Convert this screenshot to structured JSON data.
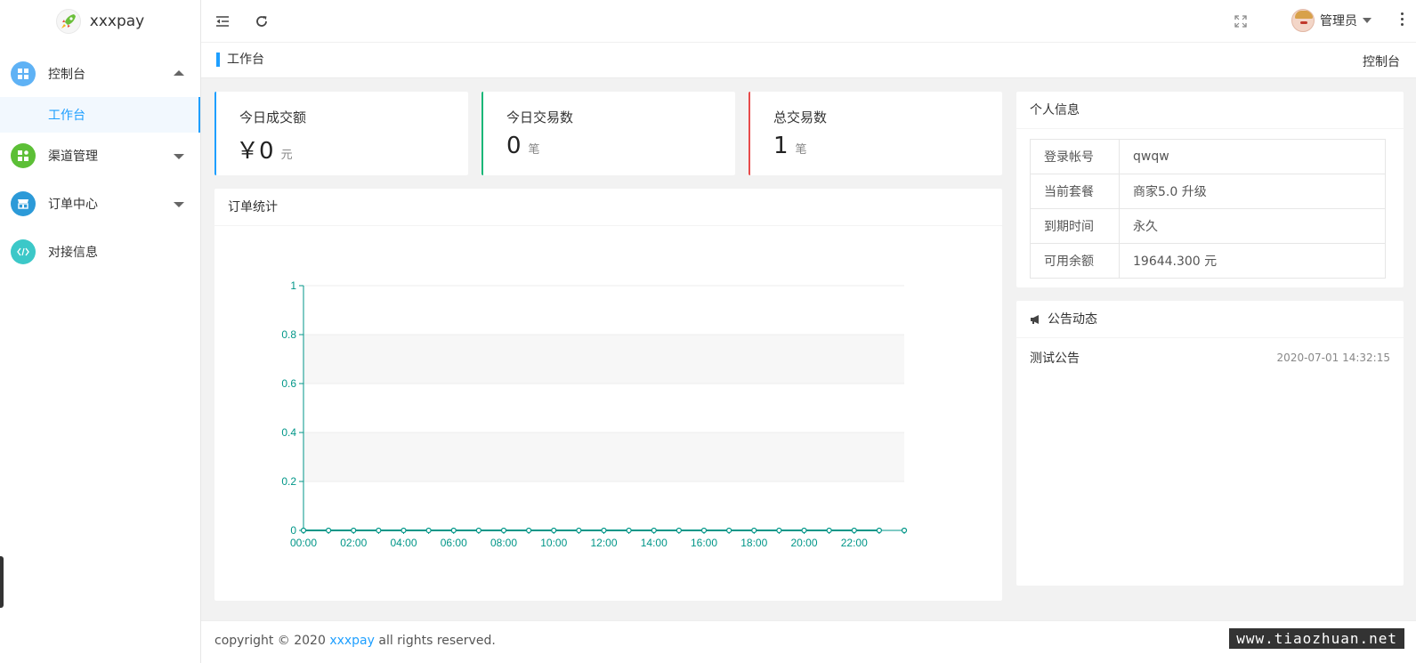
{
  "app": {
    "name": "xxxpay"
  },
  "sidebar": {
    "items": [
      {
        "label": "控制台",
        "icon": "windows-icon",
        "color": "#5fb2f5",
        "expanded": true,
        "children": [
          {
            "label": "工作台",
            "active": true
          }
        ]
      },
      {
        "label": "渠道管理",
        "icon": "apps-icon",
        "color": "#5cbf36"
      },
      {
        "label": "订单中心",
        "icon": "store-icon",
        "color": "#2c9ad8"
      },
      {
        "label": "对接信息",
        "icon": "code-icon",
        "color": "#3cc8c8"
      }
    ]
  },
  "header": {
    "user_name": "管理员"
  },
  "breadcrumb": {
    "title": "工作台",
    "right": "控制台"
  },
  "stats": [
    {
      "title": "今日成交额",
      "prefix": "￥",
      "value": "0",
      "unit": "元",
      "accent": "#1e9fff"
    },
    {
      "title": "今日交易数",
      "prefix": "",
      "value": "0",
      "unit": "笔",
      "accent": "#16b777"
    },
    {
      "title": "总交易数",
      "prefix": "",
      "value": "1",
      "unit": "笔",
      "accent": "#e84b4b"
    }
  ],
  "order_stats": {
    "title": "订单统计"
  },
  "chart_data": {
    "type": "line",
    "title": "",
    "xlabel": "",
    "ylabel": "",
    "x": [
      "00:00",
      "01:00",
      "02:00",
      "03:00",
      "04:00",
      "05:00",
      "06:00",
      "07:00",
      "08:00",
      "09:00",
      "10:00",
      "11:00",
      "12:00",
      "13:00",
      "14:00",
      "15:00",
      "16:00",
      "17:00",
      "18:00",
      "19:00",
      "20:00",
      "21:00",
      "22:00",
      "23:00"
    ],
    "x_tick_labels": [
      "00:00",
      "02:00",
      "04:00",
      "06:00",
      "08:00",
      "10:00",
      "12:00",
      "14:00",
      "16:00",
      "18:00",
      "20:00",
      "22:00"
    ],
    "series": [
      {
        "values": [
          0,
          0,
          0,
          0,
          0,
          0,
          0,
          0,
          0,
          0,
          0,
          0,
          0,
          0,
          0,
          0,
          0,
          0,
          0,
          0,
          0,
          0,
          0,
          0
        ]
      }
    ],
    "y_ticks": [
      "0",
      "0.2",
      "0.4",
      "0.6",
      "0.8",
      "1"
    ],
    "ylim": [
      0,
      1
    ],
    "grid": true,
    "color": "#009688"
  },
  "profile": {
    "title": "个人信息",
    "rows": [
      {
        "key": "登录帐号",
        "value": "qwqw"
      },
      {
        "key": "当前套餐",
        "value": "商家5.0 升级"
      },
      {
        "key": "到期时间",
        "value": "永久"
      },
      {
        "key": "可用余额",
        "value": "19644.300 元"
      }
    ]
  },
  "notice": {
    "title": "公告动态",
    "items": [
      {
        "title": "测试公告",
        "time": "2020-07-01 14:32:15"
      }
    ]
  },
  "footer": {
    "prefix": "copyright © 2020 ",
    "link": "xxxpay",
    "suffix": " all rights reserved."
  },
  "watermark": "www.tiaozhuan.net"
}
